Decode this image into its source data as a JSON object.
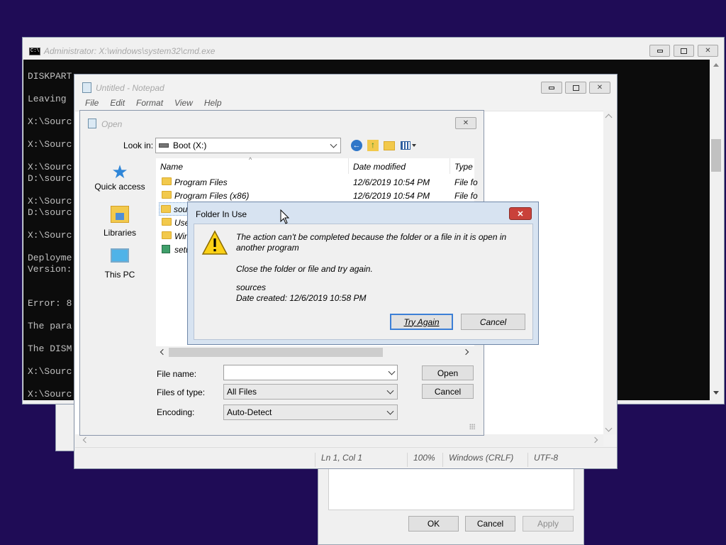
{
  "cmd": {
    "title": "Administrator: X:\\windows\\system32\\cmd.exe",
    "lines": [
      "DISKPART> exit",
      "Leaving DiskPart...",
      "X:\\Sources>",
      "X:\\Sources>",
      "X:\\Sources>",
      "D:\\sources>",
      "X:\\Sources>",
      "D:\\sources>",
      "X:\\Sources>",
      "Deployment",
      "Version:",
      "Error: 8",
      "The para",
      "The DISM",
      "X:\\Sources>",
      "X:\\Sources>"
    ],
    "visible_lines": [
      "DISKPART",
      "Leaving",
      "X:\\Sourc",
      "X:\\Sourc",
      "X:\\Sourc",
      "D:\\sourc",
      "X:\\Sourc",
      "D:\\sourc",
      "X:\\Sourc",
      "Deployme",
      "Version:",
      "Error: 8",
      "The para",
      "The DISM",
      "X:\\Sourc",
      "X:\\Sourc"
    ],
    "controls": {
      "minimize": "▭",
      "maximize": "▢",
      "close": "✕"
    }
  },
  "notepad": {
    "title": "Untitled - Notepad",
    "menu": [
      "File",
      "Edit",
      "Format",
      "View",
      "Help"
    ],
    "status": {
      "position": "Ln 1, Col 1",
      "zoom": "100%",
      "line_ending": "Windows (CRLF)",
      "encoding": "UTF-8"
    }
  },
  "open_dialog": {
    "title": "Open",
    "look_in_label": "Look in:",
    "look_in_value": "Boot (X:)",
    "places": [
      {
        "label": "Quick access",
        "icon": "star-icon"
      },
      {
        "label": "Libraries",
        "icon": "libraries-icon"
      },
      {
        "label": "This PC",
        "icon": "computer-icon"
      }
    ],
    "columns": {
      "name": "Name",
      "date": "Date modified",
      "type": "Type"
    },
    "files": [
      {
        "name": "Program Files",
        "date": "12/6/2019 10:54 PM",
        "type": "File fo"
      },
      {
        "name": "Program Files (x86)",
        "date": "12/6/2019 10:54 PM",
        "type": "File fo"
      },
      {
        "name": "sou",
        "date": "",
        "type": ""
      },
      {
        "name": "Use",
        "date": "",
        "type": ""
      },
      {
        "name": "Win",
        "date": "",
        "type": ""
      },
      {
        "name": "setu",
        "date": "",
        "type": ""
      }
    ],
    "file_name_label": "File name:",
    "file_name_value": "",
    "file_type_label": "Files of type:",
    "file_type_value": "All Files",
    "encoding_label": "Encoding:",
    "encoding_value": "Auto-Detect",
    "open_button": "Open",
    "cancel_button": "Cancel"
  },
  "error_dialog": {
    "title": "Folder In Use",
    "message1": "The action can't be completed because the folder or a file in it is open in",
    "message1b": "another program",
    "message2": "Close the folder or file and try again.",
    "item_name": "sources",
    "item_date": "Date created: 12/6/2019 10:58 PM",
    "try_again_button": "Try Again",
    "cancel_button": "Cancel",
    "close": "✕"
  },
  "back_dialog": {
    "ok_button": "OK",
    "cancel_button": "Cancel",
    "apply_button": "Apply"
  }
}
